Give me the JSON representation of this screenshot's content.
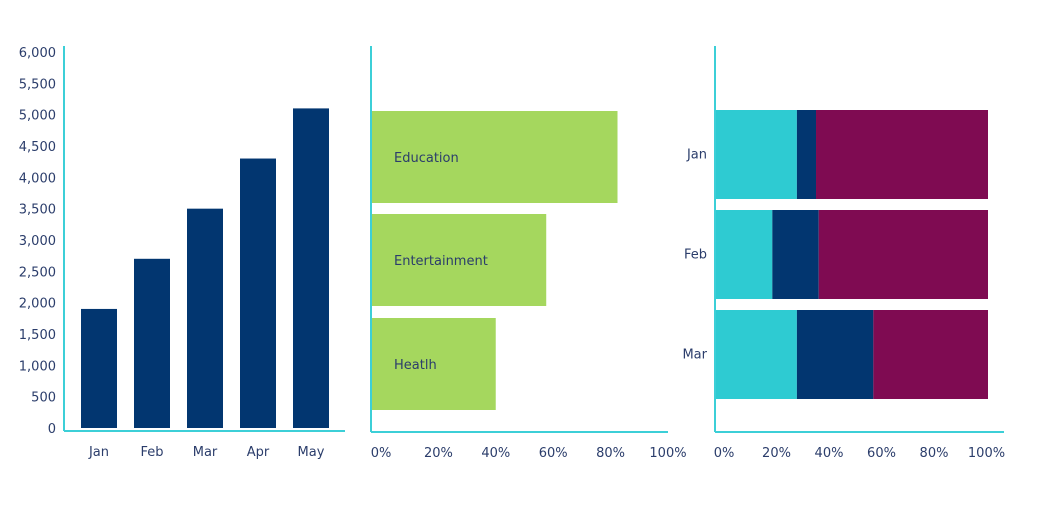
{
  "colors": {
    "axis": "#3ccfd7",
    "navy": "#023670",
    "green": "#a5d75e",
    "cyan": "#2ecbd2",
    "purple": "#7f0b52",
    "text": "#2b3d6b"
  },
  "chart_data": [
    {
      "type": "bar",
      "orientation": "vertical",
      "categories": [
        "Jan",
        "Feb",
        "Mar",
        "Apr",
        "May"
      ],
      "values": [
        1900,
        2700,
        3500,
        4300,
        5100
      ],
      "ylim": [
        0,
        6000
      ],
      "yticks": [
        "0",
        "500",
        "1,000",
        "1,500",
        "2,000",
        "2,500",
        "3,000",
        "3,500",
        "4,000",
        "4,500",
        "5,000",
        "5,500",
        "6,000"
      ],
      "grid": false
    },
    {
      "type": "bar",
      "orientation": "horizontal",
      "categories": [
        "Education",
        "Entertainment",
        "Heatlh"
      ],
      "values": [
        83,
        59,
        42
      ],
      "xlim": [
        0,
        100
      ],
      "xticks": [
        "0%",
        "20%",
        "40%",
        "60%",
        "80%",
        "100%"
      ],
      "grid": false
    },
    {
      "type": "bar",
      "orientation": "horizontal",
      "stacked": true,
      "categories": [
        "Jan",
        "Feb",
        "Mar"
      ],
      "series": [
        {
          "values": [
            30,
            21,
            30
          ]
        },
        {
          "values": [
            7,
            17,
            28
          ]
        },
        {
          "values": [
            63,
            62,
            42
          ]
        }
      ],
      "xlim": [
        0,
        100
      ],
      "xticks": [
        "0%",
        "20%",
        "40%",
        "60%",
        "80%",
        "100%"
      ],
      "grid": false
    }
  ]
}
